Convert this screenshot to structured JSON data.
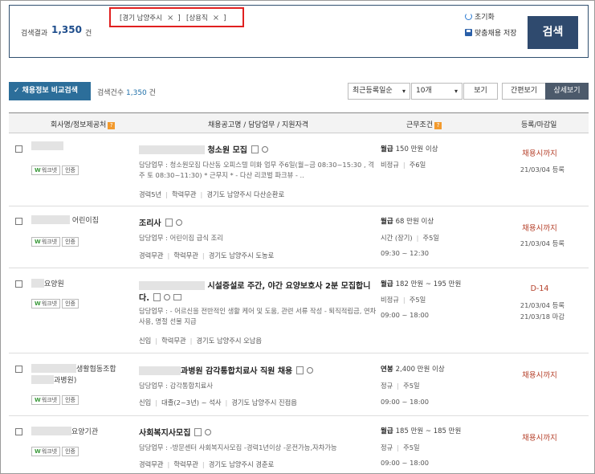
{
  "summary": {
    "result_label": "검색결과",
    "result_count": "1,350",
    "result_unit": "건",
    "chips": [
      {
        "label": "[경기 남양주시"
      },
      {
        "label": "[상용직"
      }
    ],
    "chip_close": "×",
    "chip_close_bracket": "]",
    "reset_label": "초기화",
    "save_label": "맞춤채용 저장",
    "search_label": "검색"
  },
  "toolbar": {
    "compare_label": "채용정보 비교검색",
    "count_label": "검색건수",
    "count_value": "1,350",
    "count_unit": "건",
    "sort_value": "최근등록일순",
    "page_size_value": "10개",
    "view_label": "보기",
    "simple_label": "간편보기",
    "detail_label": "상세보기"
  },
  "table": {
    "headers": {
      "company": "회사명/정보제공처",
      "title": "채용공고명 / 담당업무 / 지원자격",
      "conditions": "근무조건",
      "date": "등록/마감일"
    },
    "badges": {
      "worknet": "워크넷",
      "cert": "인증"
    },
    "rows": [
      {
        "company": "",
        "company_line2": "",
        "title": "청소원 모집",
        "duty": "담당업무 : 청소원모집 다산동 오피스텔 미화 업무 주6일(월~금 08:30~15:30 , 격주 토 08:30~11:30) * 근무지 * - 다산 리코벌 파크뷰 - ..",
        "reqs": [
          "경력5년",
          "학력무관",
          "경기도 남양주시 다산순환로"
        ],
        "pay_type": "월급",
        "pay": "150 만원 이상",
        "emp_type": "비정규",
        "days": "주6일",
        "hours": "",
        "deadline": "채용시까지",
        "reg": [
          "21/03/04 등록"
        ]
      },
      {
        "company": "어린이집",
        "company_line2": "",
        "title": "조리사",
        "duty": "담당업무 : 어린이집 급식 조리",
        "reqs": [
          "경력무관",
          "학력무관",
          "경기도 남양주시 도농로"
        ],
        "pay_type": "월급",
        "pay": "68 만원 이상",
        "emp_type": "시간 (장기)",
        "days": "주5일",
        "hours": "09:30 ~ 12:30",
        "deadline": "채용시까지",
        "reg": [
          "21/03/04 등록"
        ]
      },
      {
        "company": "요양원",
        "company_line2": "",
        "title": "시설증설로 주간, 야간 요양보호사 2분 모집합니",
        "title_line2": "다.",
        "duty": "담당업무 : - 어르신을 전반적인 생활 케어 및 도움, 관련 서류 작성 - 퇴직적립금, 연차 사용, 명절 선물 지급",
        "reqs": [
          "신입",
          "학력무관",
          "경기도 남양주시 오남읍"
        ],
        "pay_type": "월급",
        "pay": "182 만원 ~ 195 만원",
        "emp_type": "비정규",
        "days": "주5일",
        "hours": "09:00 ~ 18:00",
        "deadline": "D-14",
        "reg": [
          "21/03/04 등록",
          "21/03/18 마감"
        ]
      },
      {
        "company": "생활협동조합",
        "company_line2": "과병원)",
        "title": "과병원 감각통합치료사 직원 채용",
        "duty": "담당업무 : 감각통합치료사",
        "reqs": [
          "신입",
          "대졸(2~3년) ~ 석사",
          "경기도 남양주시 진접읍"
        ],
        "pay_type": "연봉",
        "pay": "2,400 만원 이상",
        "emp_type": "정규",
        "days": "주5일",
        "hours": "09:00 ~ 18:00",
        "deadline": "채용시까지",
        "reg": []
      },
      {
        "company": "요양기관",
        "company_line2": "",
        "title": "사회복지사모집",
        "duty": "담당업무 : -방문센터 사회복지사모집 -경력1년이상 -운전가능,자차가능",
        "reqs": [
          "경력무관",
          "학력무관",
          "경기도 남양주시 경춘로"
        ],
        "pay_type": "월급",
        "pay": "185 만원 ~ 185 만원",
        "emp_type": "정규",
        "days": "주5일",
        "hours": "09:00 ~ 18:00",
        "deadline": "채용시까지",
        "reg": []
      }
    ]
  }
}
